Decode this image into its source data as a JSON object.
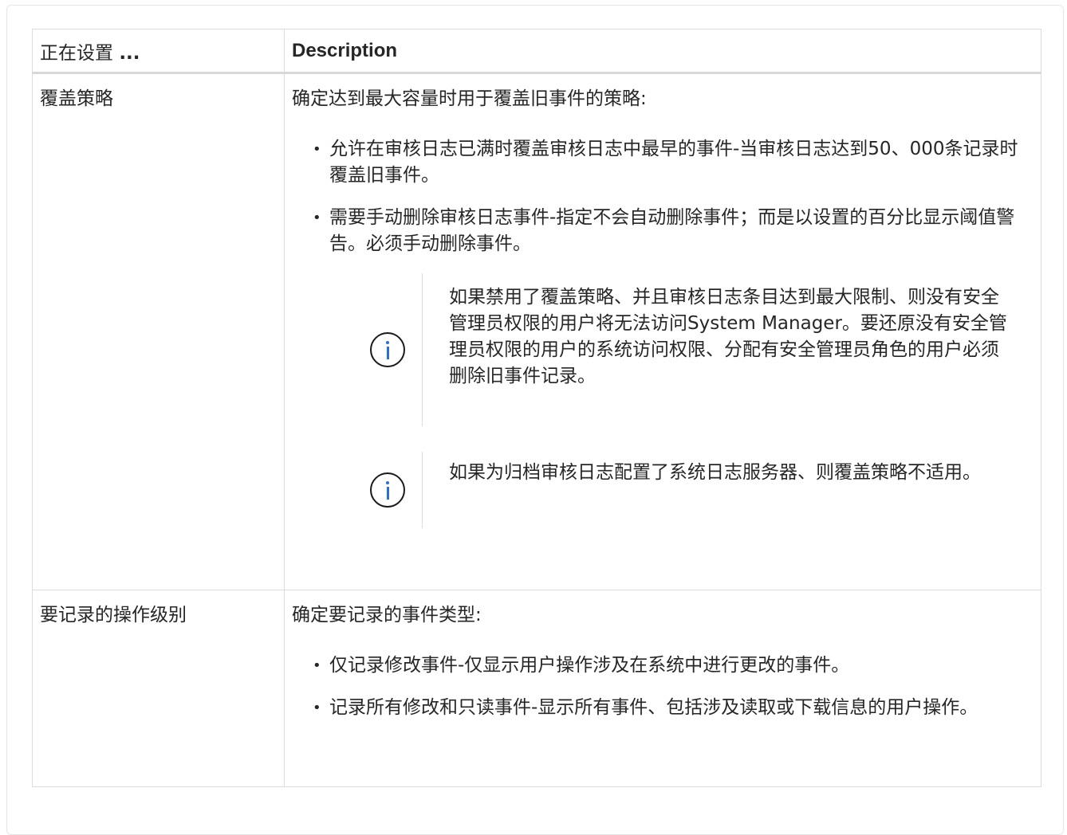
{
  "table": {
    "headers": {
      "setting": "正在设置",
      "ellipsis": "...",
      "description": "Description"
    },
    "rows": [
      {
        "setting": "覆盖策略",
        "lead": "确定达到最大容量时用于覆盖旧事件的策略:",
        "bullets": [
          "允许在审核日志已满时覆盖审核日志中最早的事件-当审核日志达到50、000条记录时覆盖旧事件。",
          "需要手动删除审核日志事件-指定不会自动删除事件；而是以设置的百分比显示阈值警告。必须手动删除事件。"
        ],
        "notes": [
          "如果禁用了覆盖策略、并且审核日志条目达到最大限制、则没有安全管理员权限的用户将无法访问System Manager。要还原没有安全管理员权限的用户的系统访问权限、分配有安全管理员角色的用户必须删除旧事件记录。",
          "如果为归档审核日志配置了系统日志服务器、则覆盖策略不适用。"
        ]
      },
      {
        "setting": "要记录的操作级别",
        "lead": "确定要记录的事件类型:",
        "bullets": [
          "仅记录修改事件-仅显示用户操作涉及在系统中进行更改的事件。",
          "记录所有修改和只读事件-显示所有事件、包括涉及读取或下载信息的用户操作。"
        ]
      }
    ]
  },
  "icons": {
    "note_icon": "info-circle-icon",
    "bullet_icon": "bullet-dot-icon"
  },
  "colors": {
    "text": "#262626",
    "border": "#dcdcdc",
    "info_accent": "#2a6fd6"
  }
}
